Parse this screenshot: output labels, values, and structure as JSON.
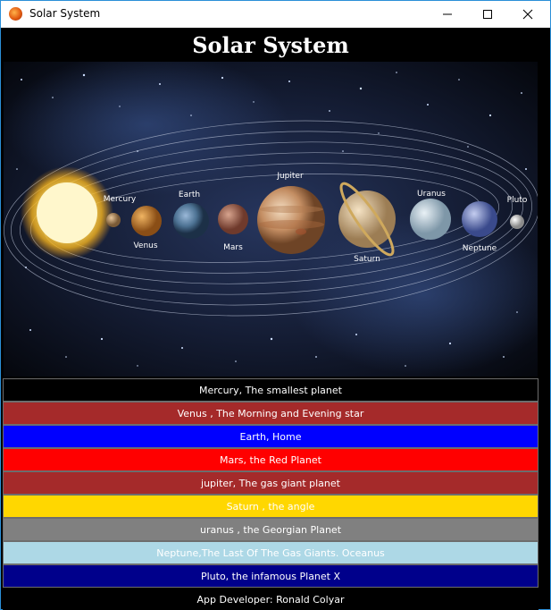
{
  "window": {
    "title": "Solar System",
    "controls": {
      "minimize": "─",
      "maximize": "□",
      "close": "✕"
    }
  },
  "heading": "Solar System",
  "scene": {
    "labels": {
      "mercury": "Mercury",
      "venus": "Venus",
      "earth": "Earth",
      "mars": "Mars",
      "jupiter": "Jupiter",
      "saturn": "Saturn",
      "uranus": "Uranus",
      "neptune": "Neptune",
      "pluto": "Pluto"
    }
  },
  "rows": [
    {
      "label": "Mercury, The smallest planet",
      "bg": "#000000",
      "fg": "#ffffff"
    },
    {
      "label": "Venus , The Morning and Evening star",
      "bg": "#a52a2a",
      "fg": "#ffffff"
    },
    {
      "label": "Earth, Home",
      "bg": "#0000ff",
      "fg": "#ffffff"
    },
    {
      "label": "Mars, the Red Planet",
      "bg": "#ff0000",
      "fg": "#ffffff"
    },
    {
      "label": "jupiter, The gas giant planet",
      "bg": "#a52a2a",
      "fg": "#ffffff"
    },
    {
      "label": "Saturn , the angle",
      "bg": "#ffd700",
      "fg": "#ffffff"
    },
    {
      "label": "uranus , the Georgian Planet",
      "bg": "#808080",
      "fg": "#ffffff"
    },
    {
      "label": "Neptune,The Last Of The Gas Giants. Oceanus",
      "bg": "#add8e6",
      "fg": "#ffffff"
    },
    {
      "label": "Pluto, the infamous Planet X",
      "bg": "#00008b",
      "fg": "#ffffff"
    }
  ],
  "footer": "App Developer: Ronald Colyar"
}
